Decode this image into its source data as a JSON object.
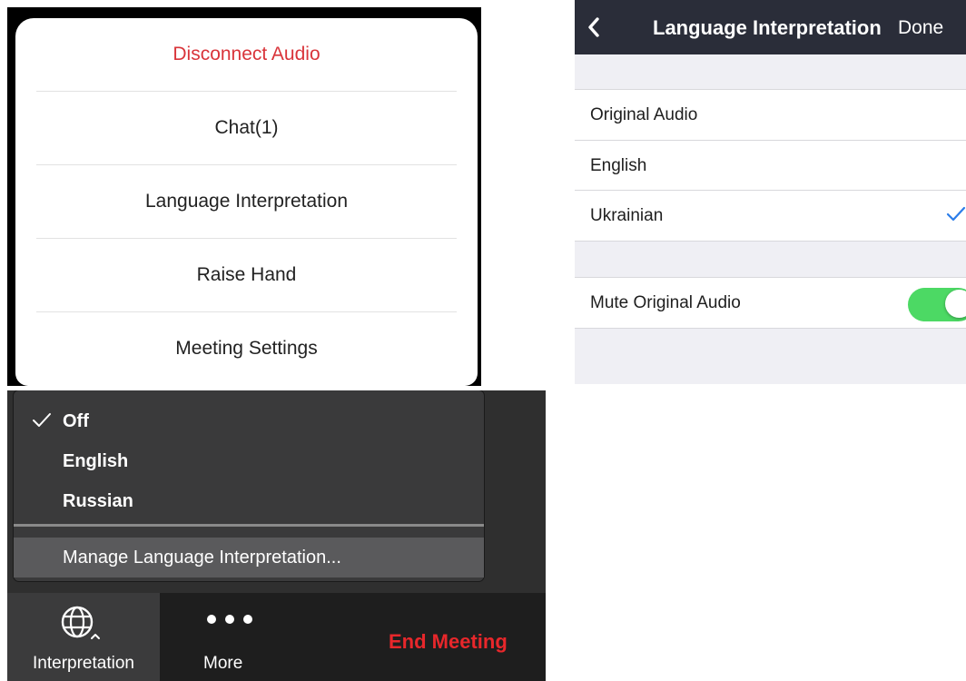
{
  "action_sheet": {
    "items": [
      {
        "label": "Disconnect Audio",
        "color": "#d9343a"
      },
      {
        "label": "Chat(1)"
      },
      {
        "label": "Language Interpretation"
      },
      {
        "label": "Raise Hand"
      },
      {
        "label": "Meeting Settings"
      }
    ]
  },
  "ios_settings": {
    "title": "Language Interpretation",
    "done_label": "Done",
    "back_icon": "chevron-left-icon",
    "languages": [
      "Original Audio",
      "English",
      "Ukrainian"
    ],
    "selected_language": "Ukrainian",
    "mute_label": "Mute Original Audio",
    "mute_on": true,
    "toggle_color": "#4cd964",
    "check_color": "#2b7de9"
  },
  "desktop_menu": {
    "items": [
      "Off",
      "English",
      "Russian"
    ],
    "checked_item": "Off",
    "manage_label": "Manage Language Interpretation..."
  },
  "toolbar": {
    "interpretation_label": "Interpretation",
    "more_label": "More",
    "end_label": "End Meeting",
    "end_color": "#e8272b"
  }
}
